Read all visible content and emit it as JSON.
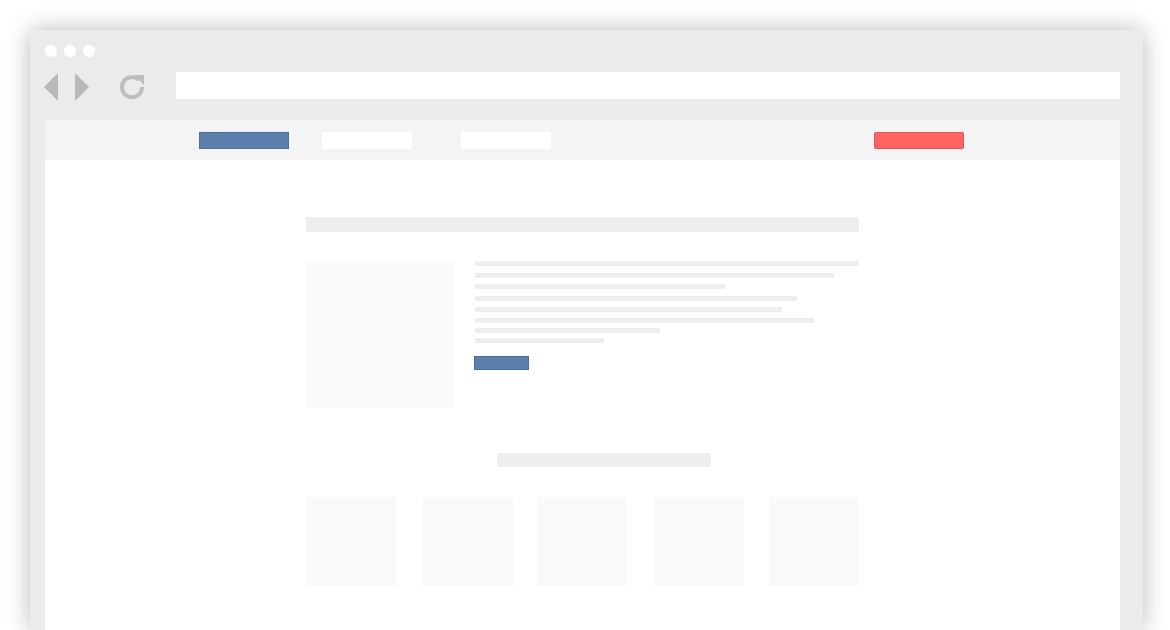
{
  "browser": {
    "window_controls": [
      "dot",
      "dot",
      "dot"
    ],
    "back_icon": "chevron-left-icon",
    "forward_icon": "chevron-right-icon",
    "reload_icon": "reload-icon",
    "address_value": "",
    "address_placeholder": ""
  },
  "nav": {
    "items": [
      {
        "label": "",
        "style": "primary"
      },
      {
        "label": "",
        "style": "plain"
      },
      {
        "label": "",
        "style": "plain"
      }
    ],
    "cta_label": ""
  },
  "content": {
    "page_title": "",
    "intro_text_lines": [
      "",
      "",
      "",
      "",
      "",
      "",
      "",
      ""
    ],
    "intro_button_label": "",
    "section_heading": "",
    "cards": [
      "",
      "",
      "",
      "",
      ""
    ]
  },
  "colors": {
    "primary": "#5b80ad",
    "accent": "#fd6462",
    "frame": "#ebebeb",
    "nav_bg": "#f4f4f4",
    "placeholder": "#eeeeee",
    "card": "#f9f9f9"
  }
}
